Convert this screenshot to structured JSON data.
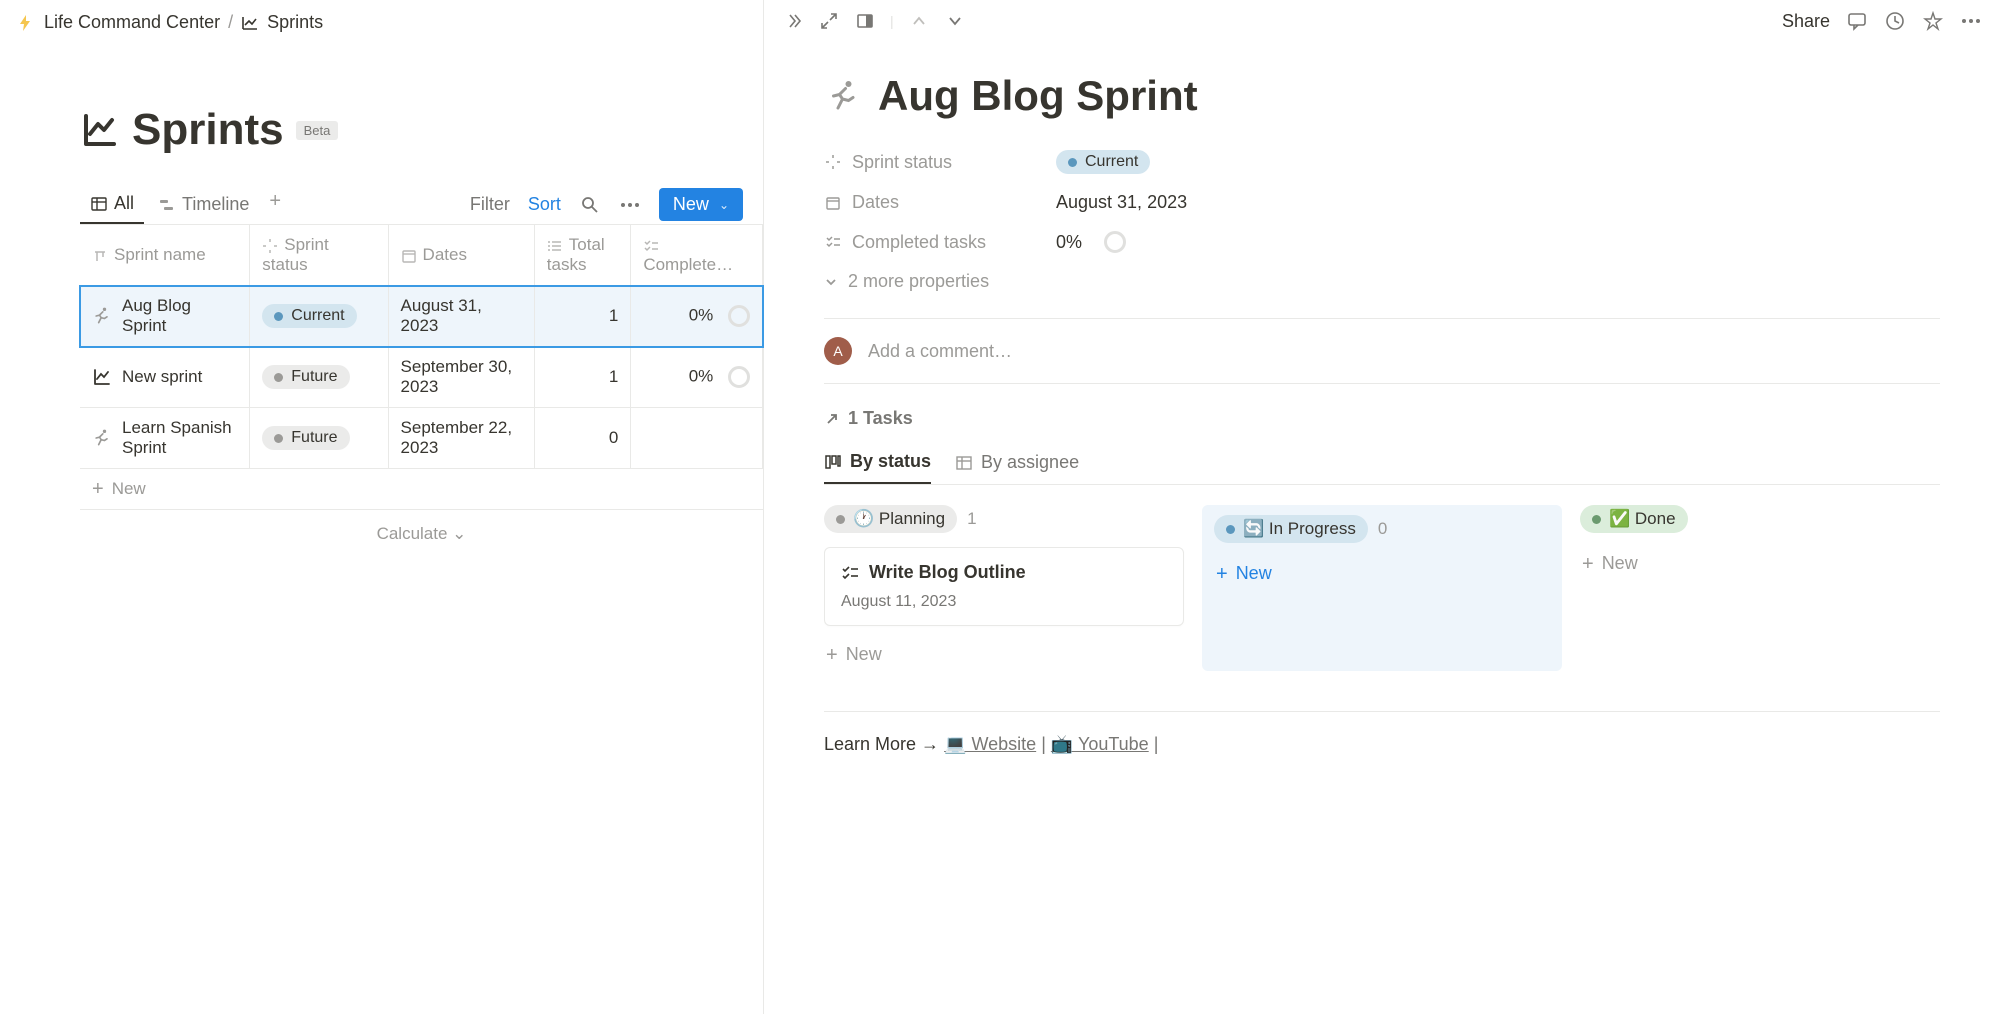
{
  "breadcrumb": {
    "parent": "Life Command Center",
    "current": "Sprints"
  },
  "page": {
    "title": "Sprints",
    "badge": "Beta"
  },
  "views": {
    "all": "All",
    "timeline": "Timeline"
  },
  "toolbar": {
    "filter": "Filter",
    "sort": "Sort",
    "new": "New"
  },
  "columns": {
    "name": "Sprint name",
    "status": "Sprint status",
    "dates": "Dates",
    "total": "Total tasks",
    "completed": "Complete…"
  },
  "rows": [
    {
      "name": "Aug Blog Sprint",
      "status": "Current",
      "statusKind": "current",
      "date": "August 31, 2023",
      "total": "1",
      "completed": "0%",
      "iconKind": "runner"
    },
    {
      "name": "New sprint",
      "status": "Future",
      "statusKind": "future",
      "date": "September 30, 2023",
      "total": "1",
      "completed": "0%",
      "iconKind": "chart"
    },
    {
      "name": "Learn Spanish Sprint",
      "status": "Future",
      "statusKind": "future",
      "date": "September 22, 2023",
      "total": "0",
      "completed": "",
      "iconKind": "runner"
    }
  ],
  "newRow": "New",
  "calculate": "Calculate",
  "rightTop": {
    "share": "Share"
  },
  "detail": {
    "title": "Aug Blog Sprint",
    "props": {
      "statusLabel": "Sprint status",
      "statusValue": "Current",
      "datesLabel": "Dates",
      "datesValue": "August 31, 2023",
      "completedLabel": "Completed tasks",
      "completedValue": "0%"
    },
    "moreProps": "2 more properties",
    "commentPlaceholder": "Add a comment…",
    "avatarInitial": "A",
    "tasksLink": "1 Tasks",
    "boardTabs": {
      "byStatus": "By status",
      "byAssignee": "By assignee"
    },
    "cols": {
      "planning": {
        "label": "🕐 Planning",
        "count": "1"
      },
      "inprogress": {
        "label": "🔄 In Progress",
        "count": "0"
      },
      "done": {
        "label": "✅ Done"
      }
    },
    "cards": {
      "planning": [
        {
          "title": "Write Blog Outline",
          "date": "August 11, 2023"
        }
      ]
    },
    "colNew": "New",
    "learnMore": {
      "prefix": "Learn More → ",
      "website": "💻 Website",
      "youtube": "📺 YouTube"
    }
  }
}
